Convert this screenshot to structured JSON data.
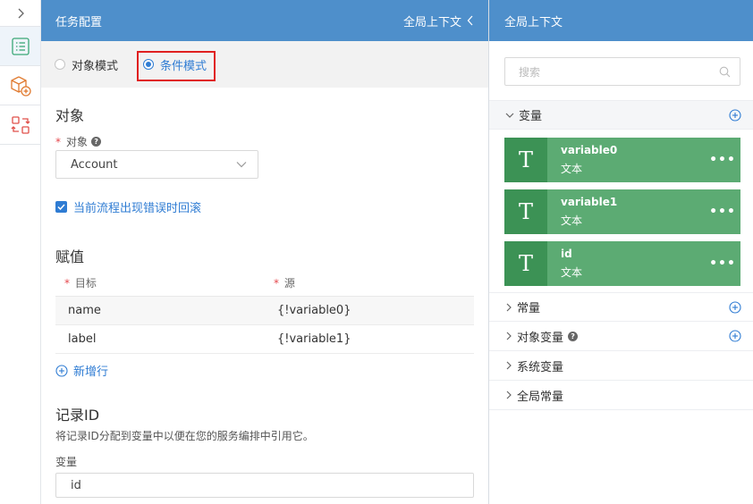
{
  "colors": {
    "header_blue": "#4e8fcb",
    "accent": "#2f7cd3",
    "card_green": "#5cab73",
    "card_green_dark": "#3c9255",
    "highlight_red": "#e02020"
  },
  "rail": {
    "icons": [
      "chevron-right-icon",
      "list-icon",
      "cube-add-icon",
      "swap-icon"
    ]
  },
  "task": {
    "title": "任务配置",
    "global_context_label": "全局上下文",
    "modes": {
      "object_mode": "对象模式",
      "condition_mode": "条件模式",
      "selected": "条件模式"
    },
    "object_section": {
      "title": "对象",
      "field_label": "对象",
      "value": "Account"
    },
    "rollback_label": "当前流程出现错误时回滚",
    "assign": {
      "title": "赋值",
      "col_target": "目标",
      "col_source": "源",
      "rows": [
        {
          "target": "name",
          "source": "{!variable0}"
        },
        {
          "target": "label",
          "source": "{!variable1}"
        }
      ],
      "add_row_label": "新增行"
    },
    "record": {
      "title": "记录ID",
      "description": "将记录ID分配到变量中以便在您的服务编排中引用它。",
      "var_label": "变量",
      "var_value": "id"
    }
  },
  "context": {
    "title": "全局上下文",
    "search_placeholder": "搜索",
    "groups": {
      "variables": "变量",
      "constants": "常量",
      "object_variables": "对象变量",
      "system_variables": "系统变量",
      "global_constants": "全局常量"
    },
    "variables": [
      {
        "name": "variable0",
        "type": "文本",
        "icon_letter": "T"
      },
      {
        "name": "variable1",
        "type": "文本",
        "icon_letter": "T"
      },
      {
        "name": "id",
        "type": "文本",
        "icon_letter": "T"
      }
    ],
    "more_glyph": "•••"
  }
}
